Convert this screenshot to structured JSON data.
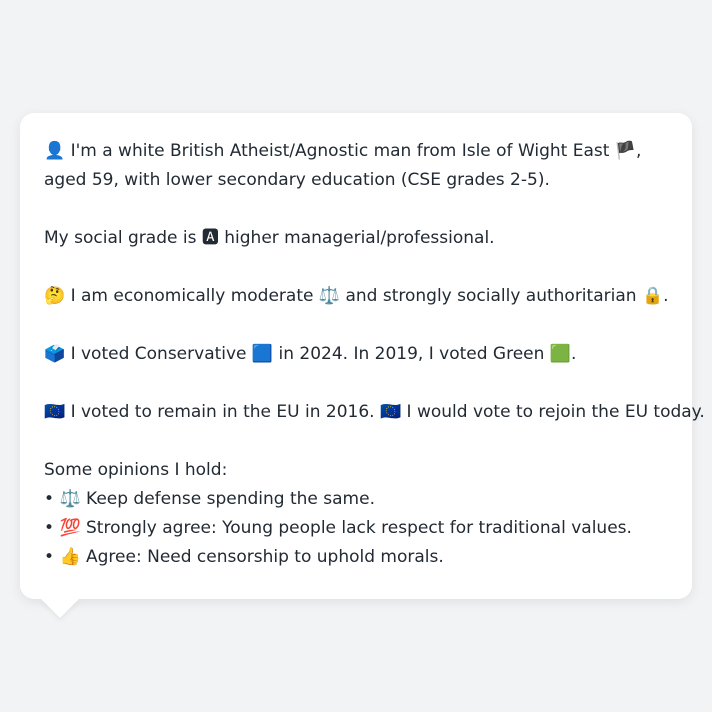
{
  "message": {
    "identity": {
      "person_icon": "👤",
      "text_1": "I'm a white British Atheist/Agnostic man from Isle of Wight East",
      "flag_icon": "🏴",
      "text_2": ", aged 59, with lower secondary education (CSE grades 2-5)."
    },
    "social_grade": {
      "text_1": "My social grade is",
      "grade_icon": "🅰",
      "text_2": "higher managerial/professional."
    },
    "economic": {
      "thinking_icon": "🤔",
      "text_1": "I am economically moderate",
      "scales_icon": "⚖️",
      "text_2": "and strongly socially authoritarian",
      "lock_icon": "🔒",
      "text_3": "."
    },
    "vote": {
      "ballot_icon": "🗳️",
      "text_1": "I voted Conservative",
      "blue_icon": "🟦",
      "text_2": "in 2024. In 2019, I voted Green",
      "green_icon": "🟩",
      "text_3": "."
    },
    "eu": {
      "eu_icon_1": "🇪🇺",
      "text_1": "I voted to remain in the EU in 2016.",
      "eu_icon_2": "🇪🇺",
      "text_2": "I would vote to rejoin the EU today."
    },
    "opinions": {
      "heading": "Some opinions I hold:",
      "bullet": "•",
      "items": [
        {
          "icon": "⚖️",
          "text": "Keep defense spending the same."
        },
        {
          "icon": "💯",
          "text": "Strongly agree: Young people lack respect for traditional values."
        },
        {
          "icon": "👍",
          "text": "Agree: Need censorship to uphold morals."
        }
      ]
    }
  },
  "colors": {
    "background": "#f2f3f5",
    "bubble": "#ffffff",
    "text": "#222a33"
  }
}
